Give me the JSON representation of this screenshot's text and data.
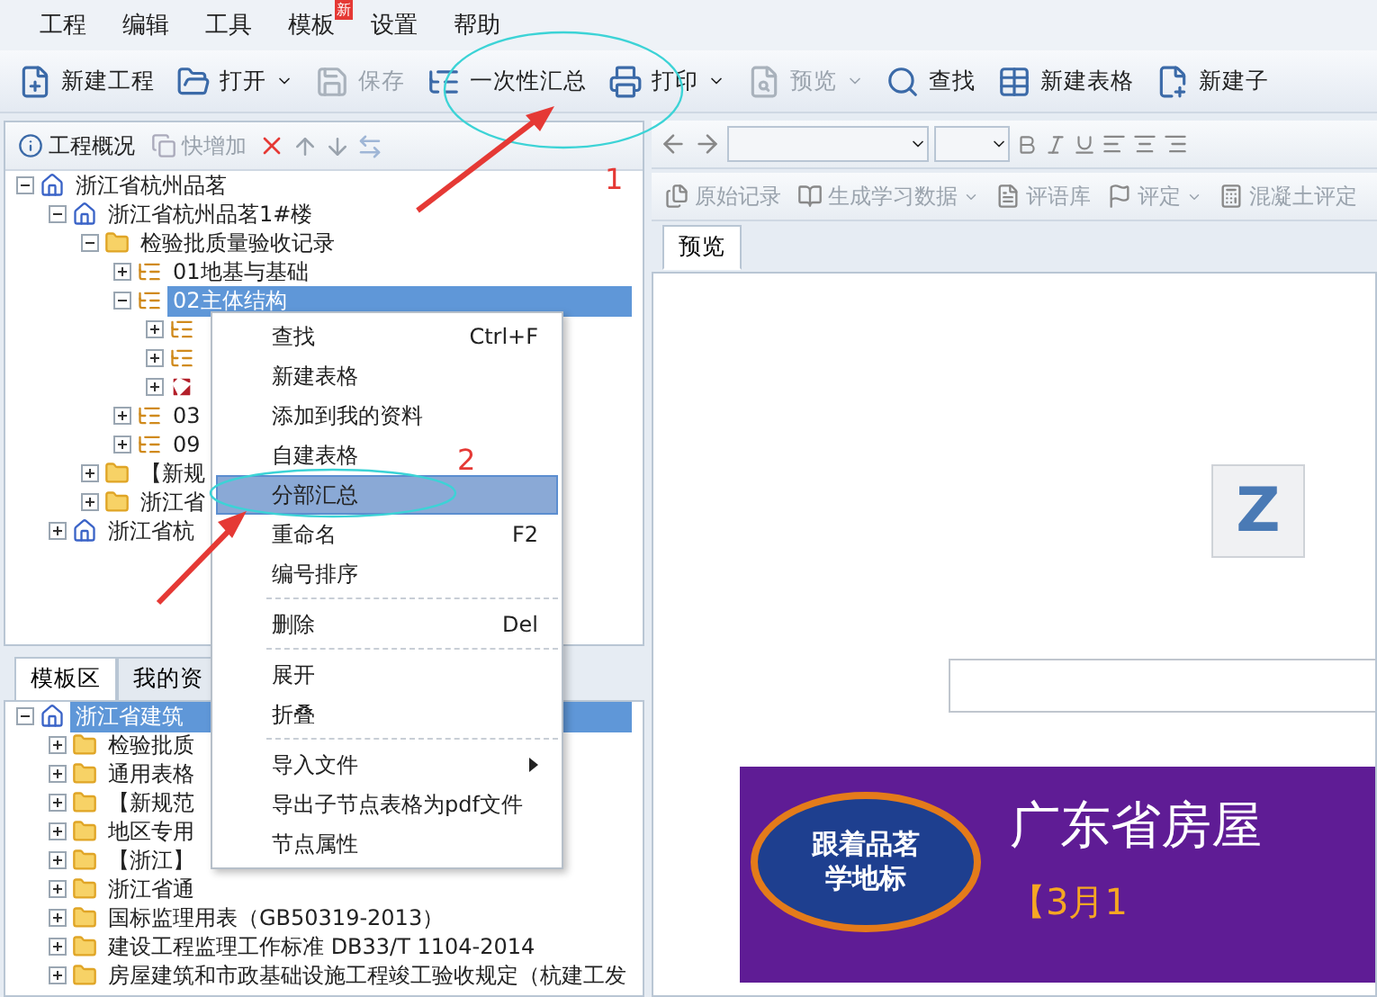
{
  "menu_bar": [
    {
      "label": "工程"
    },
    {
      "label": "编辑"
    },
    {
      "label": "工具"
    },
    {
      "label": "模板",
      "badge": "新"
    },
    {
      "label": "设置"
    },
    {
      "label": "帮助"
    }
  ],
  "toolbar": [
    {
      "label": "新建工程",
      "disabled": false,
      "dropdown": false
    },
    {
      "label": "打开",
      "disabled": false,
      "dropdown": true
    },
    {
      "label": "保存",
      "disabled": true,
      "dropdown": false
    },
    {
      "label": "一次性汇总",
      "disabled": false,
      "dropdown": false
    },
    {
      "label": "打印",
      "disabled": false,
      "dropdown": true
    },
    {
      "label": "预览",
      "disabled": true,
      "dropdown": true
    },
    {
      "label": "查找",
      "disabled": false,
      "dropdown": false
    },
    {
      "label": "新建表格",
      "disabled": false,
      "dropdown": false
    },
    {
      "label": "新建子",
      "disabled": false,
      "dropdown": false
    }
  ],
  "project_panel": {
    "toolbar": [
      {
        "label": "工程概况",
        "disabled": false
      },
      {
        "label": "快增加",
        "disabled": true
      }
    ],
    "tree": [
      {
        "label": "浙江省杭州品茗",
        "kind": "home",
        "expanded": true,
        "selected": false,
        "children": [
          {
            "label": "浙江省杭州品茗1#楼",
            "kind": "home",
            "expanded": true,
            "selected": false,
            "children": [
              {
                "label": "检验批质量验收记录",
                "kind": "folder",
                "expanded": true,
                "selected": false,
                "children": [
                  {
                    "label": "01地基与基础",
                    "kind": "list",
                    "expanded": false,
                    "selected": false
                  },
                  {
                    "label": "02主体结构",
                    "kind": "list",
                    "expanded": true,
                    "selected": true,
                    "children": [
                      {
                        "kind": "list",
                        "expanded": false
                      },
                      {
                        "kind": "list",
                        "expanded": false
                      },
                      {
                        "kind": "table",
                        "expanded": false
                      }
                    ]
                  },
                  {
                    "label": "03",
                    "kind": "list",
                    "expanded": false,
                    "selected": false
                  },
                  {
                    "label": "09",
                    "kind": "list",
                    "expanded": false,
                    "selected": false
                  }
                ]
              },
              {
                "label": "【新规",
                "kind": "folder",
                "expanded": false,
                "selected": false
              },
              {
                "label": "浙江省",
                "kind": "folder",
                "expanded": false,
                "selected": false
              }
            ]
          },
          {
            "label": "浙江省杭",
            "kind": "home",
            "expanded": false,
            "selected": false
          }
        ]
      }
    ]
  },
  "template_panel": {
    "tabs": [
      {
        "label": "模板区",
        "selected": true
      },
      {
        "label": "我的资",
        "selected": false
      }
    ],
    "tree": [
      {
        "label": "浙江省建筑",
        "kind": "home",
        "expanded": true,
        "selected": true,
        "children": [
          {
            "label": "检验批质",
            "kind": "folder",
            "expanded": false,
            "selected": false
          },
          {
            "label": "通用表格",
            "kind": "folder",
            "expanded": false,
            "selected": false
          },
          {
            "label": "【新规范",
            "kind": "folder",
            "expanded": false,
            "selected": false
          },
          {
            "label": "地区专用",
            "kind": "folder",
            "expanded": false,
            "selected": false
          },
          {
            "label": "【浙江】",
            "kind": "folder",
            "expanded": false,
            "selected": false
          },
          {
            "label": "浙江省通",
            "kind": "folder",
            "expanded": false,
            "selected": false
          },
          {
            "label": "国标监理用表（GB50319-2013）",
            "kind": "folder",
            "expanded": false,
            "selected": false
          },
          {
            "label": "建设工程监理工作标准 DB33/T 1104-2014",
            "kind": "folder",
            "expanded": false,
            "selected": false
          },
          {
            "label": "房屋建筑和市政基础设施工程竣工验收规定（杭建工发",
            "kind": "folder",
            "expanded": false,
            "selected": false
          }
        ]
      }
    ]
  },
  "context_menu": [
    {
      "label": "查找",
      "shortcut": "Ctrl+F",
      "selected": false
    },
    {
      "label": "新建表格",
      "selected": false
    },
    {
      "label": "添加到我的资料",
      "selected": false
    },
    {
      "label": "自建表格",
      "selected": false
    },
    {
      "label": "分部汇总",
      "selected": true
    },
    {
      "label": "重命名",
      "shortcut": "F2",
      "selected": false
    },
    {
      "label": "编号排序",
      "selected": false
    },
    {
      "kind": "separator"
    },
    {
      "label": "删除",
      "shortcut": "Del",
      "selected": false
    },
    {
      "kind": "separator"
    },
    {
      "label": "展开",
      "selected": false
    },
    {
      "label": "折叠",
      "selected": false
    },
    {
      "kind": "separator"
    },
    {
      "label": "导入文件",
      "submenu": true,
      "selected": false
    },
    {
      "label": "导出子节点表格为pdf文件",
      "selected": false
    },
    {
      "label": "节点属性",
      "selected": false
    }
  ],
  "editor_toolbar": [
    {
      "label": "原始记录",
      "dropdown": false
    },
    {
      "label": "生成学习数据",
      "dropdown": true
    },
    {
      "label": "评语库",
      "dropdown": false
    },
    {
      "label": "评定",
      "dropdown": true
    },
    {
      "label": "混凝土评定",
      "dropdown": false
    }
  ],
  "document_tabs": [
    {
      "label": "预览",
      "selected": true
    }
  ],
  "preview": {
    "logo_letter": "Z",
    "banner": {
      "badge_lines": [
        "跟着品茗",
        "学地标"
      ],
      "title": "广东省房屋",
      "subtitle": "【3月1"
    }
  },
  "annotations": [
    {
      "number": "1"
    },
    {
      "number": "2"
    }
  ]
}
